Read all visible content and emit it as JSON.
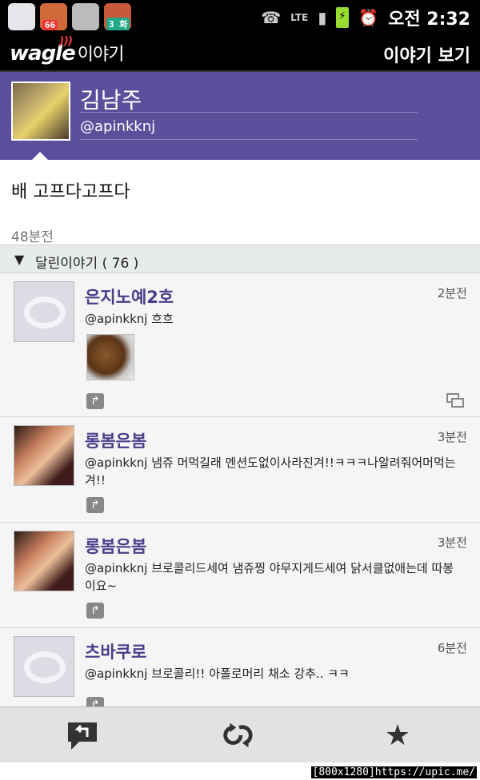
{
  "statusbar": {
    "badges": [
      "66",
      "3 화"
    ],
    "network": "LTE",
    "time": "오전 2:32"
  },
  "appbar": {
    "logo_text": "wagle",
    "logo_sub": "이야기",
    "title": "이야기 보기"
  },
  "profile": {
    "name": "김남주",
    "handle": "@apinkknj"
  },
  "post": {
    "text": "배 고프다고프다",
    "time": "48분전"
  },
  "replies": {
    "label": "달린이야기 ( 76 )",
    "items": [
      {
        "name": "은지노예2호",
        "ago": "2분전",
        "msg": "@apinkknj 흐흐"
      },
      {
        "name": "롱봄은봄",
        "ago": "3분전",
        "msg": "@apinkknj 냄쥬 머먹길래 멘션도없이사라진겨!!ㅋㅋㅋ나알려줘어머먹는겨!!"
      },
      {
        "name": "롱봄은봄",
        "ago": "3분전",
        "msg": "@apinkknj 브로콜리드세여 냄쥬찡 야무지게드세여 닭서클없애는데 따봉이요~"
      },
      {
        "name": "츠바쿠로",
        "ago": "6분전",
        "msg": "@apinkknj 브로콜리!! 아폴로머리 채소 강추.. ㅋㅋ"
      }
    ]
  },
  "watermark": "[800x1280]https://upic.me/",
  "colors": {
    "header_purple": "#5b4f9c",
    "username_purple": "#4a3e8a"
  }
}
